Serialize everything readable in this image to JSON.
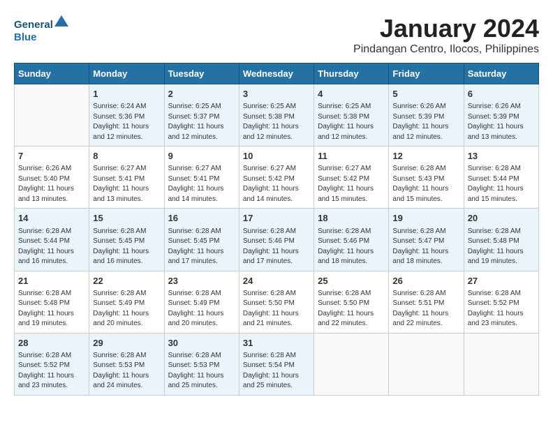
{
  "header": {
    "logo_line1": "General",
    "logo_line2": "Blue",
    "title": "January 2024",
    "subtitle": "Pindangan Centro, Ilocos, Philippines"
  },
  "days_of_week": [
    "Sunday",
    "Monday",
    "Tuesday",
    "Wednesday",
    "Thursday",
    "Friday",
    "Saturday"
  ],
  "weeks": [
    [
      {
        "day": "",
        "info": ""
      },
      {
        "day": "1",
        "info": "Sunrise: 6:24 AM\nSunset: 5:36 PM\nDaylight: 11 hours\nand 12 minutes."
      },
      {
        "day": "2",
        "info": "Sunrise: 6:25 AM\nSunset: 5:37 PM\nDaylight: 11 hours\nand 12 minutes."
      },
      {
        "day": "3",
        "info": "Sunrise: 6:25 AM\nSunset: 5:38 PM\nDaylight: 11 hours\nand 12 minutes."
      },
      {
        "day": "4",
        "info": "Sunrise: 6:25 AM\nSunset: 5:38 PM\nDaylight: 11 hours\nand 12 minutes."
      },
      {
        "day": "5",
        "info": "Sunrise: 6:26 AM\nSunset: 5:39 PM\nDaylight: 11 hours\nand 12 minutes."
      },
      {
        "day": "6",
        "info": "Sunrise: 6:26 AM\nSunset: 5:39 PM\nDaylight: 11 hours\nand 13 minutes."
      }
    ],
    [
      {
        "day": "7",
        "info": "Sunrise: 6:26 AM\nSunset: 5:40 PM\nDaylight: 11 hours\nand 13 minutes."
      },
      {
        "day": "8",
        "info": "Sunrise: 6:27 AM\nSunset: 5:41 PM\nDaylight: 11 hours\nand 13 minutes."
      },
      {
        "day": "9",
        "info": "Sunrise: 6:27 AM\nSunset: 5:41 PM\nDaylight: 11 hours\nand 14 minutes."
      },
      {
        "day": "10",
        "info": "Sunrise: 6:27 AM\nSunset: 5:42 PM\nDaylight: 11 hours\nand 14 minutes."
      },
      {
        "day": "11",
        "info": "Sunrise: 6:27 AM\nSunset: 5:42 PM\nDaylight: 11 hours\nand 15 minutes."
      },
      {
        "day": "12",
        "info": "Sunrise: 6:28 AM\nSunset: 5:43 PM\nDaylight: 11 hours\nand 15 minutes."
      },
      {
        "day": "13",
        "info": "Sunrise: 6:28 AM\nSunset: 5:44 PM\nDaylight: 11 hours\nand 15 minutes."
      }
    ],
    [
      {
        "day": "14",
        "info": "Sunrise: 6:28 AM\nSunset: 5:44 PM\nDaylight: 11 hours\nand 16 minutes."
      },
      {
        "day": "15",
        "info": "Sunrise: 6:28 AM\nSunset: 5:45 PM\nDaylight: 11 hours\nand 16 minutes."
      },
      {
        "day": "16",
        "info": "Sunrise: 6:28 AM\nSunset: 5:45 PM\nDaylight: 11 hours\nand 17 minutes."
      },
      {
        "day": "17",
        "info": "Sunrise: 6:28 AM\nSunset: 5:46 PM\nDaylight: 11 hours\nand 17 minutes."
      },
      {
        "day": "18",
        "info": "Sunrise: 6:28 AM\nSunset: 5:46 PM\nDaylight: 11 hours\nand 18 minutes."
      },
      {
        "day": "19",
        "info": "Sunrise: 6:28 AM\nSunset: 5:47 PM\nDaylight: 11 hours\nand 18 minutes."
      },
      {
        "day": "20",
        "info": "Sunrise: 6:28 AM\nSunset: 5:48 PM\nDaylight: 11 hours\nand 19 minutes."
      }
    ],
    [
      {
        "day": "21",
        "info": "Sunrise: 6:28 AM\nSunset: 5:48 PM\nDaylight: 11 hours\nand 19 minutes."
      },
      {
        "day": "22",
        "info": "Sunrise: 6:28 AM\nSunset: 5:49 PM\nDaylight: 11 hours\nand 20 minutes."
      },
      {
        "day": "23",
        "info": "Sunrise: 6:28 AM\nSunset: 5:49 PM\nDaylight: 11 hours\nand 20 minutes."
      },
      {
        "day": "24",
        "info": "Sunrise: 6:28 AM\nSunset: 5:50 PM\nDaylight: 11 hours\nand 21 minutes."
      },
      {
        "day": "25",
        "info": "Sunrise: 6:28 AM\nSunset: 5:50 PM\nDaylight: 11 hours\nand 22 minutes."
      },
      {
        "day": "26",
        "info": "Sunrise: 6:28 AM\nSunset: 5:51 PM\nDaylight: 11 hours\nand 22 minutes."
      },
      {
        "day": "27",
        "info": "Sunrise: 6:28 AM\nSunset: 5:52 PM\nDaylight: 11 hours\nand 23 minutes."
      }
    ],
    [
      {
        "day": "28",
        "info": "Sunrise: 6:28 AM\nSunset: 5:52 PM\nDaylight: 11 hours\nand 23 minutes."
      },
      {
        "day": "29",
        "info": "Sunrise: 6:28 AM\nSunset: 5:53 PM\nDaylight: 11 hours\nand 24 minutes."
      },
      {
        "day": "30",
        "info": "Sunrise: 6:28 AM\nSunset: 5:53 PM\nDaylight: 11 hours\nand 25 minutes."
      },
      {
        "day": "31",
        "info": "Sunrise: 6:28 AM\nSunset: 5:54 PM\nDaylight: 11 hours\nand 25 minutes."
      },
      {
        "day": "",
        "info": ""
      },
      {
        "day": "",
        "info": ""
      },
      {
        "day": "",
        "info": ""
      }
    ]
  ]
}
